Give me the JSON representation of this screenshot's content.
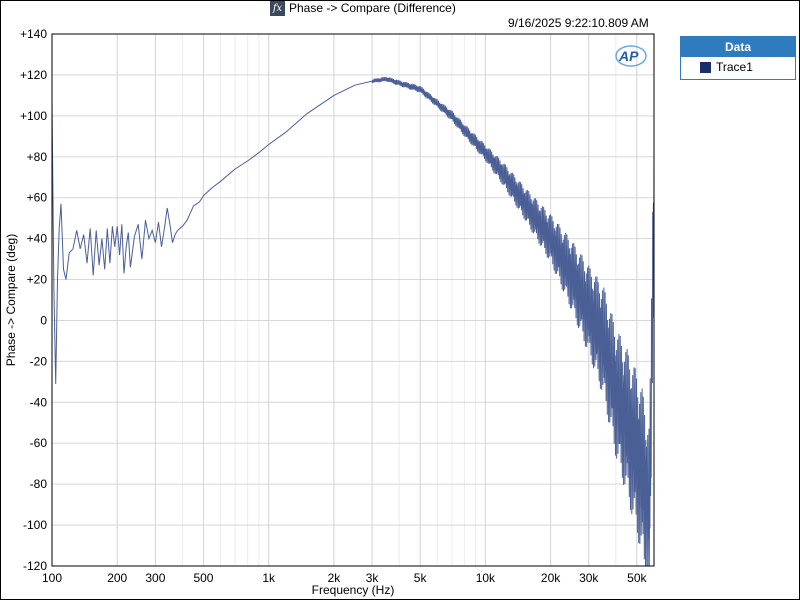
{
  "window": {
    "title": "Phase -> Compare (Difference)",
    "fx_icon": "fx-icon",
    "timestamp": "9/16/2025 9:22:10.809 AM",
    "logo_text": "AP"
  },
  "legend": {
    "header": "Data",
    "items": [
      {
        "label": "Trace1",
        "color": "#1a2e6b"
      }
    ]
  },
  "colors": {
    "trace": "#4a5f95",
    "grid": "#d7d7d7",
    "minor_grid": "#ececec",
    "legend_header": "#2e7bbd"
  },
  "chart_data": {
    "type": "line",
    "title": "Phase -> Compare (Difference)",
    "xlabel": "Frequency (Hz)",
    "ylabel": "Phase -> Compare (deg)",
    "x_scale": "log",
    "xlim": [
      100,
      60000
    ],
    "ylim": [
      -120,
      140
    ],
    "grid": true,
    "legend_position": "right",
    "x_ticks": [
      100,
      200,
      300,
      500,
      1000,
      2000,
      3000,
      5000,
      10000,
      20000,
      30000,
      50000
    ],
    "x_tick_labels": [
      "100",
      "200",
      "300",
      "500",
      "1k",
      "2k",
      "3k",
      "5k",
      "10k",
      "20k",
      "30k",
      "50k"
    ],
    "y_ticks": [
      -120,
      -100,
      -80,
      -60,
      -40,
      -20,
      0,
      20,
      40,
      60,
      80,
      100,
      120,
      140
    ],
    "y_tick_labels": [
      "-120",
      "-100",
      "-80",
      "-60",
      "-40",
      "-20",
      "0",
      "+20",
      "+40",
      "+60",
      "+80",
      "+100",
      "+120",
      "+140"
    ],
    "series": [
      {
        "name": "Trace1",
        "x": [
          100,
          102,
          104,
          106,
          108,
          110,
          113,
          116,
          120,
          125,
          130,
          135,
          140,
          145,
          150,
          155,
          160,
          165,
          170,
          175,
          180,
          185,
          190,
          195,
          200,
          205,
          210,
          215,
          220,
          225,
          230,
          240,
          250,
          260,
          270,
          280,
          290,
          300,
          310,
          320,
          330,
          340,
          350,
          360,
          370,
          380,
          400,
          420,
          450,
          480,
          500,
          550,
          600,
          700,
          800,
          900,
          1000,
          1200,
          1500,
          2000,
          2500,
          3000,
          3500,
          4000,
          5000,
          6000,
          7000,
          8000,
          10000,
          12000,
          15000,
          20000,
          25000,
          30000,
          35000,
          40000,
          45000,
          50000,
          53000,
          55000,
          57000,
          58000,
          59000,
          60000
        ],
        "y": [
          107,
          15,
          -31,
          20,
          45,
          57,
          25,
          20,
          33,
          35,
          44,
          35,
          42,
          28,
          45,
          22,
          44,
          27,
          40,
          25,
          45,
          28,
          46,
          36,
          46,
          32,
          47,
          23,
          36,
          43,
          26,
          41,
          47,
          30,
          49,
          40,
          44,
          38,
          48,
          36,
          45,
          55,
          47,
          38,
          42,
          44,
          46,
          49,
          56,
          58,
          61,
          65,
          68,
          74,
          78,
          82,
          86,
          92,
          101,
          110,
          115,
          117,
          118,
          116,
          113,
          106,
          100,
          93,
          82,
          72,
          58,
          40,
          22,
          5,
          -10,
          -35,
          -50,
          -65,
          -75,
          -85,
          -95,
          -60,
          10,
          55
        ],
        "noise_envelope": [
          [
            3000,
            1
          ],
          [
            6000,
            2
          ],
          [
            10000,
            4
          ],
          [
            15000,
            8
          ],
          [
            20000,
            12
          ],
          [
            30000,
            22
          ],
          [
            40000,
            32
          ],
          [
            50000,
            40
          ],
          [
            60000,
            45
          ]
        ]
      }
    ]
  }
}
